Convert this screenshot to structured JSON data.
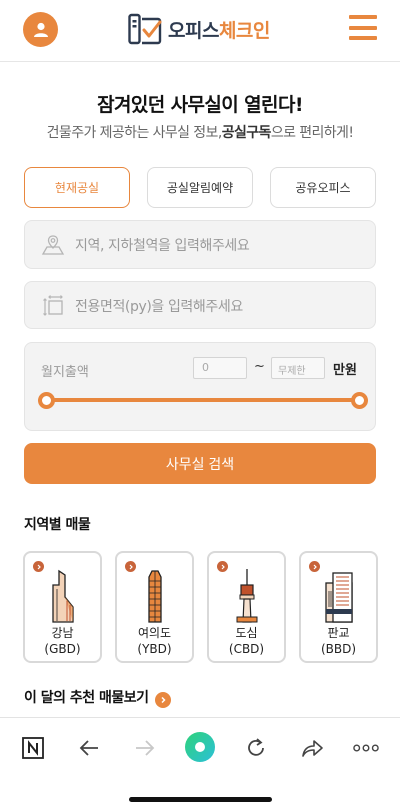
{
  "header": {
    "logo_text_main": "오피스",
    "logo_text_accent": "체크인",
    "colors": {
      "accent": "#e8873e",
      "navy": "#2d3a4f"
    }
  },
  "hero": {
    "title": "잠겨있던 사무실이 열린다!",
    "subtitle_prefix": "건물주가 제공하는 사무실 정보,",
    "subtitle_bold": "공실구독",
    "subtitle_suffix": "으로 편리하게!"
  },
  "tabs": [
    {
      "label": "현재공실",
      "active": true
    },
    {
      "label": "공실알림예약",
      "active": false
    },
    {
      "label": "공유오피스",
      "active": false
    }
  ],
  "search": {
    "location_placeholder": "지역, 지하철역을 입력해주세요",
    "area_placeholder": "전용면적(py)을 입력해주세요",
    "rent_label": "월지출액",
    "rent_min_placeholder": "0",
    "rent_tilde": "~",
    "rent_max_placeholder": "무제한",
    "rent_unit": "만원",
    "slider_range": [
      0,
      1
    ],
    "button_label": "사무실 검색"
  },
  "regions": {
    "title": "지역별 매물",
    "items": [
      {
        "name": "강남",
        "code": "(GBD)",
        "icon": "gangnam-building-icon"
      },
      {
        "name": "여의도",
        "code": "(YBD)",
        "icon": "yeouido-tower-icon"
      },
      {
        "name": "도심",
        "code": "(CBD)",
        "icon": "namsan-tower-icon"
      },
      {
        "name": "판교",
        "code": "(BBD)",
        "icon": "pangyo-building-icon"
      }
    ]
  },
  "recommend": {
    "title": "이 달의 추천 매물보기"
  },
  "browser_bar": {
    "items": [
      "naver-n-icon",
      "back-arrow-icon",
      "forward-arrow-icon",
      "green-dot-icon",
      "reload-icon",
      "share-icon",
      "more-dots-icon"
    ]
  }
}
